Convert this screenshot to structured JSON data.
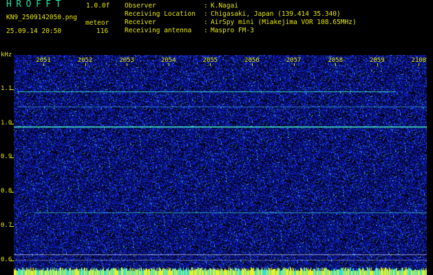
{
  "header": {
    "app_title": "HROFFT",
    "app_version": "1.0.0f",
    "file_name": "KN9_2509142050.png",
    "mode_label": "meteor",
    "date_time": "25.09.14 20:50",
    "count": "116",
    "info": [
      {
        "label": "Observer",
        "value": "K.Nagai"
      },
      {
        "label": "Receiving Location",
        "value": "Chigasaki, Japan (139.414 35.340)"
      },
      {
        "label": "Receiver",
        "value": "AirSpy mini (Miakejima VOR 108.65MHz)"
      },
      {
        "label": "Receiving antenna",
        "value": "Maspro FM-3"
      }
    ]
  },
  "axis": {
    "y_unit": "kHz",
    "y_ticks": [
      "1.1",
      "1.0",
      "0.9",
      "0.8",
      "0.7",
      "0.6"
    ],
    "x_ticks": [
      "2051",
      "2052",
      "2053",
      "2054",
      "2055",
      "2056",
      "2057",
      "2058",
      "2059",
      "2100"
    ]
  },
  "colors": {
    "background": "#000000",
    "noise": "#1a2bd0",
    "text": "#e8e800",
    "title": "#22e0a0",
    "carrier": "#40ffc0"
  }
}
